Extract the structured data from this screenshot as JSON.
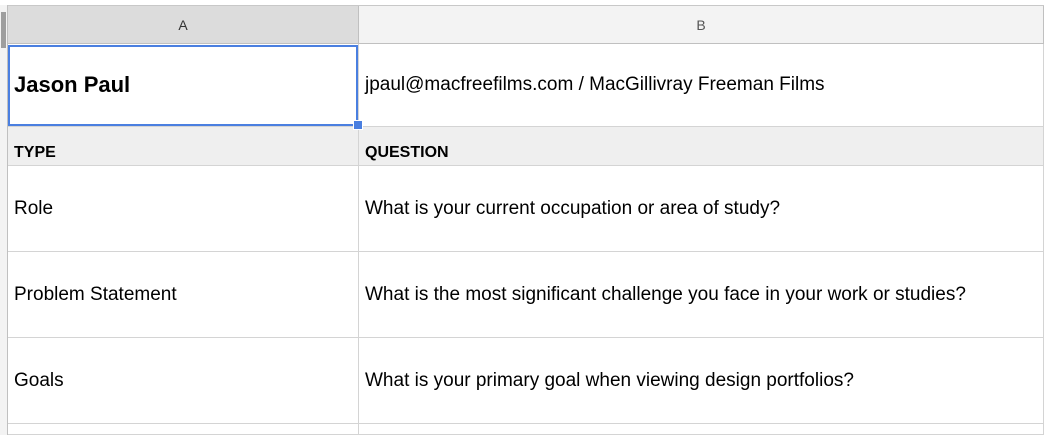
{
  "columns": {
    "a": "A",
    "b": "B"
  },
  "rows": [
    {
      "a": "Jason Paul",
      "b": "jpaul@macfreefilms.com / MacGillivray Freeman Films"
    },
    {
      "a": "TYPE",
      "b": "QUESTION"
    },
    {
      "a": "Role",
      "b": "What is your current occupation or area of study?"
    },
    {
      "a": "Problem Statement",
      "b": "What is the most significant challenge you face in your work or studies?"
    },
    {
      "a": "Goals",
      "b": "What is your primary goal when viewing design portfolios?"
    }
  ],
  "colors": {
    "selection": "#4a7fe0",
    "header_row_bg": "#efefef",
    "column_header_bg": "#f3f3f3"
  }
}
